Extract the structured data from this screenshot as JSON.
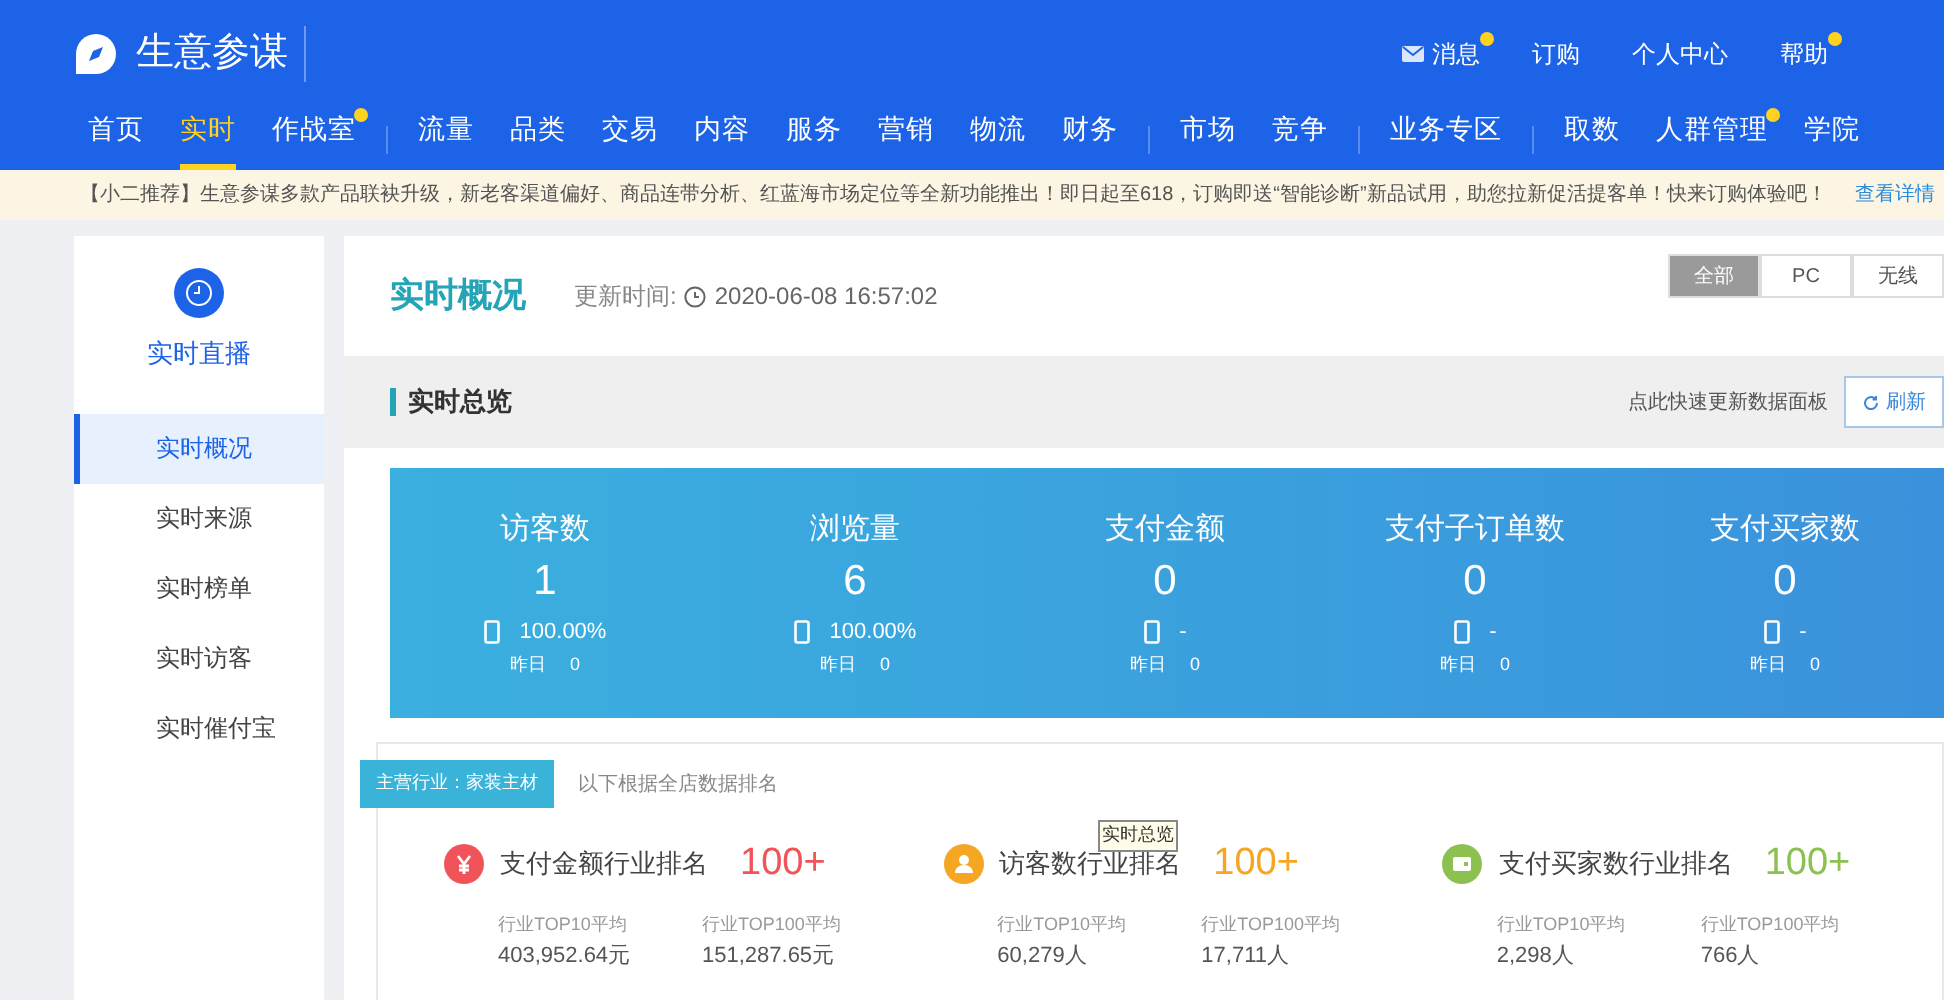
{
  "header": {
    "logo": "生意参谋",
    "links": [
      {
        "label": "消息",
        "badge": true
      },
      {
        "label": "订购",
        "badge": false
      },
      {
        "label": "个人中心",
        "badge": false
      },
      {
        "label": "帮助",
        "badge": true
      }
    ]
  },
  "nav_groups": [
    [
      {
        "label": "首页",
        "selected": false,
        "badge": false
      },
      {
        "label": "实时",
        "selected": true,
        "badge": false
      },
      {
        "label": "作战室",
        "selected": false,
        "badge": true
      }
    ],
    [
      {
        "label": "流量",
        "selected": false,
        "badge": false
      },
      {
        "label": "品类",
        "selected": false,
        "badge": false
      },
      {
        "label": "交易",
        "selected": false,
        "badge": false
      },
      {
        "label": "内容",
        "selected": false,
        "badge": false
      },
      {
        "label": "服务",
        "selected": false,
        "badge": false
      },
      {
        "label": "营销",
        "selected": false,
        "badge": false
      },
      {
        "label": "物流",
        "selected": false,
        "badge": false
      },
      {
        "label": "财务",
        "selected": false,
        "badge": false
      }
    ],
    [
      {
        "label": "市场",
        "selected": false,
        "badge": false
      },
      {
        "label": "竞争",
        "selected": false,
        "badge": false
      }
    ],
    [
      {
        "label": "业务专区",
        "selected": false,
        "badge": false
      }
    ],
    [
      {
        "label": "取数",
        "selected": false,
        "badge": false
      },
      {
        "label": "人群管理",
        "selected": false,
        "badge": true
      },
      {
        "label": "学院",
        "selected": false,
        "badge": false
      }
    ]
  ],
  "notice": {
    "text": "【小二推荐】生意参谋多款产品联袂升级，新老客渠道偏好、商品连带分析、红蓝海市场定位等全新功能推出！即日起至618，订购即送“智能诊断”新品试用，助您拉新促活提客单！快来订购体验吧！",
    "link": "查看详情"
  },
  "sidebar": {
    "title": "实时直播",
    "items": [
      {
        "label": "实时概况",
        "selected": true
      },
      {
        "label": "实时来源",
        "selected": false
      },
      {
        "label": "实时榜单",
        "selected": false
      },
      {
        "label": "实时访客",
        "selected": false
      },
      {
        "label": "实时催付宝",
        "selected": false
      }
    ]
  },
  "page": {
    "title": "实时概况",
    "updated_label": "更新时间:",
    "updated_time": "2020-06-08 16:57:02",
    "device_tabs": [
      {
        "label": "全部",
        "selected": true
      },
      {
        "label": "PC",
        "selected": false
      },
      {
        "label": "无线",
        "selected": false
      }
    ]
  },
  "overview": {
    "title": "实时总览",
    "hint": "点此快速更新数据面板",
    "refresh": "刷新"
  },
  "stats": [
    {
      "label": "访客数",
      "value": "1",
      "share": "100.00%",
      "yesterday_label": "昨日",
      "yesterday": "0"
    },
    {
      "label": "浏览量",
      "value": "6",
      "share": "100.00%",
      "yesterday_label": "昨日",
      "yesterday": "0"
    },
    {
      "label": "支付金额",
      "value": "0",
      "share": "-",
      "yesterday_label": "昨日",
      "yesterday": "0"
    },
    {
      "label": "支付子订单数",
      "value": "0",
      "share": "-",
      "yesterday_label": "昨日",
      "yesterday": "0"
    },
    {
      "label": "支付买家数",
      "value": "0",
      "share": "-",
      "yesterday_label": "昨日",
      "yesterday": "0"
    }
  ],
  "ranking": {
    "industry_tag": "主营行业：家装主材",
    "note": "以下根据全店数据排名",
    "tooltip": "实时总览",
    "items": [
      {
        "kind": "money",
        "color": "#f0535a",
        "title": "支付金额行业排名",
        "rank": "100+",
        "top10_label": "行业TOP10平均",
        "top10": "403,952.64元",
        "top100_label": "行业TOP100平均",
        "top100": "151,287.65元"
      },
      {
        "kind": "person",
        "color": "#f5a623",
        "title": "访客数行业排名",
        "rank": "100+",
        "top10_label": "行业TOP10平均",
        "top10": "60,279人",
        "top100_label": "行业TOP100平均",
        "top100": "17,711人"
      },
      {
        "kind": "card",
        "color": "#8cc152",
        "title": "支付买家数行业排名",
        "rank": "100+",
        "top10_label": "行业TOP10平均",
        "top10": "2,298人",
        "top100_label": "行业TOP100平均",
        "top100": "766人"
      }
    ]
  }
}
